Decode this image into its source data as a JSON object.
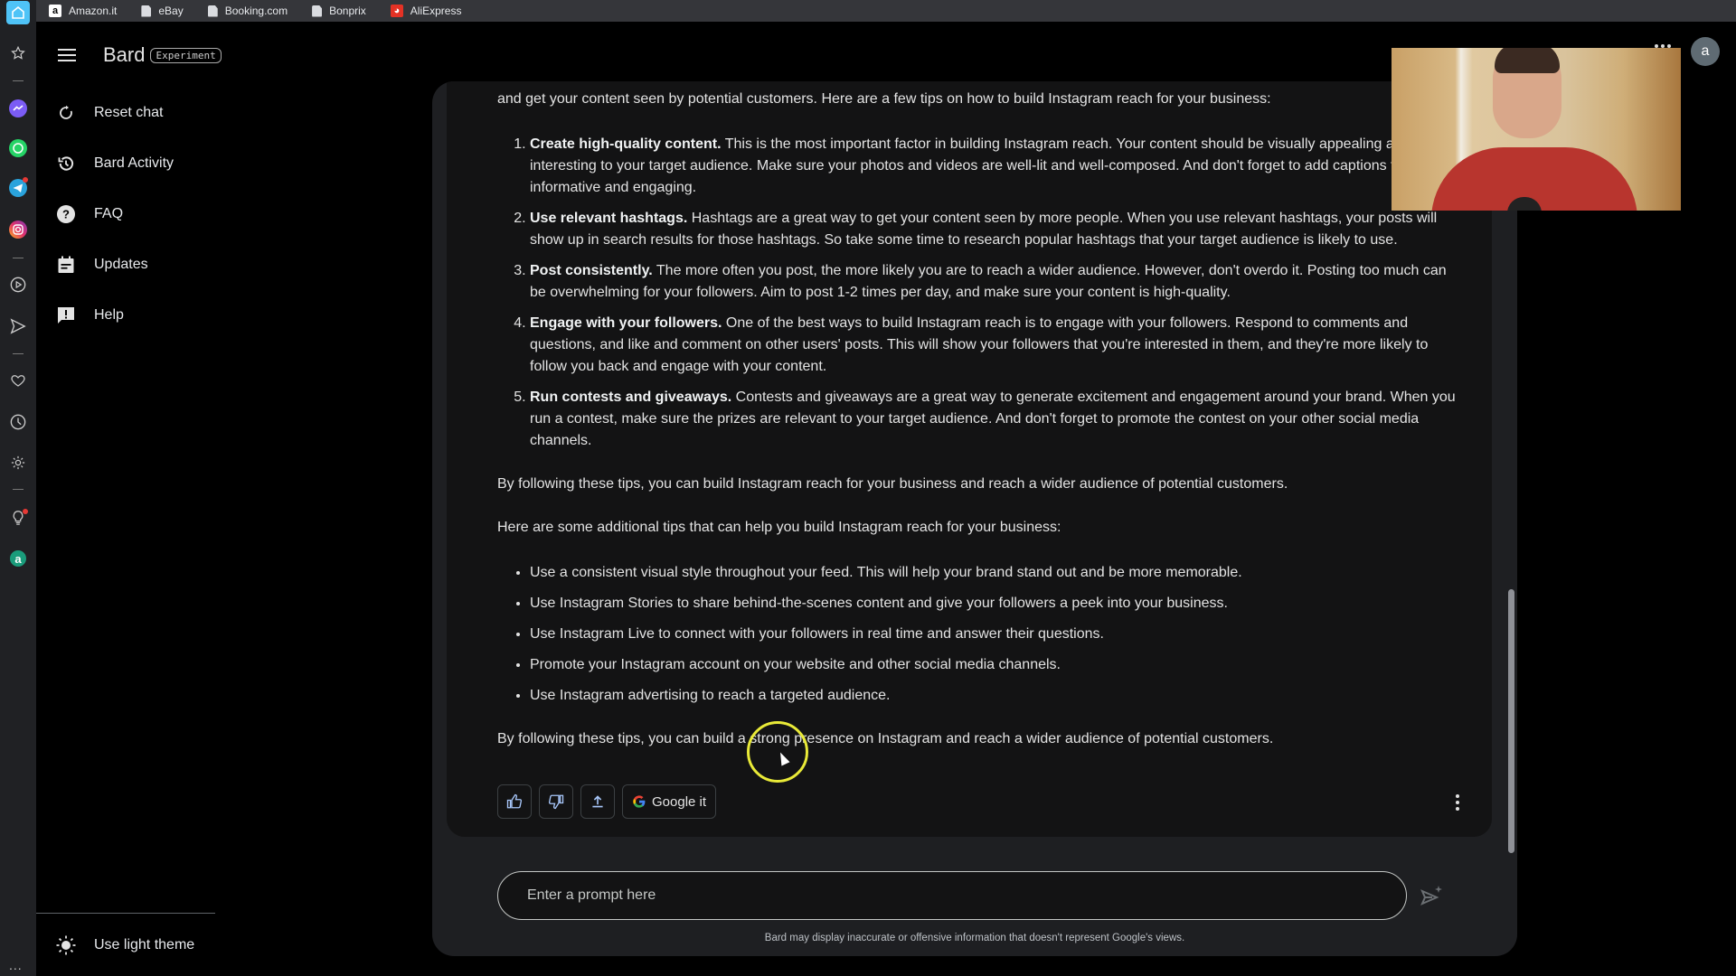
{
  "browser": {
    "bookmarks": [
      {
        "label": "Amazon.it",
        "icon": "amazon-icon"
      },
      {
        "label": "eBay",
        "icon": "page-icon"
      },
      {
        "label": "Booking.com",
        "icon": "page-icon"
      },
      {
        "label": "Bonprix",
        "icon": "page-icon"
      },
      {
        "label": "AliExpress",
        "icon": "aliexpress-icon"
      }
    ]
  },
  "app_rail": {
    "icons": [
      "home-icon",
      "star-icon",
      "messenger-icon",
      "whatsapp-icon",
      "telegram-icon",
      "instagram-icon",
      "play-icon",
      "send-icon",
      "heart-icon",
      "clock-icon",
      "gear-icon",
      "lightbulb-icon",
      "account-icon"
    ],
    "account_letter": "a",
    "more_label": "..."
  },
  "sidebar": {
    "brand": "Bard",
    "badge": "Experiment",
    "items": [
      {
        "label": "Reset chat",
        "icon": "reset-icon"
      },
      {
        "label": "Bard Activity",
        "icon": "history-icon"
      },
      {
        "label": "FAQ",
        "icon": "help-circle-icon"
      },
      {
        "label": "Updates",
        "icon": "calendar-icon"
      },
      {
        "label": "Help",
        "icon": "feedback-icon"
      }
    ],
    "theme_toggle": "Use light theme"
  },
  "response": {
    "intro": "and get your content seen by potential customers. Here are a few tips on how to build Instagram reach for your business:",
    "tips": [
      {
        "title": "Create high-quality content.",
        "body": " This is the most important factor in building Instagram reach. Your content should be visually appealing and interesting to your target audience. Make sure your photos and videos are well-lit and well-composed. And don't forget to add captions that are informative and engaging."
      },
      {
        "title": "Use relevant hashtags.",
        "body": " Hashtags are a great way to get your content seen by more people. When you use relevant hashtags, your posts will show up in search results for those hashtags. So take some time to research popular hashtags that your target audience is likely to use."
      },
      {
        "title": "Post consistently.",
        "body": " The more often you post, the more likely you are to reach a wider audience. However, don't overdo it. Posting too much can be overwhelming for your followers. Aim to post 1-2 times per day, and make sure your content is high-quality."
      },
      {
        "title": "Engage with your followers.",
        "body": " One of the best ways to build Instagram reach is to engage with your followers. Respond to comments and questions, and like and comment on other users' posts. This will show your followers that you're interested in them, and they're more likely to follow you back and engage with your content."
      },
      {
        "title": "Run contests and giveaways.",
        "body": " Contests and giveaways are a great way to generate excitement and engagement around your brand. When you run a contest, make sure the prizes are relevant to your target audience. And don't forget to promote the contest on your other social media channels."
      }
    ],
    "summary1": "By following these tips, you can build Instagram reach for your business and reach a wider audience of potential customers.",
    "additional_intro": "Here are some additional tips that can help you build Instagram reach for your business:",
    "additional_tips": [
      "Use a consistent visual style throughout your feed. This will help your brand stand out and be more memorable.",
      "Use Instagram Stories to share behind-the-scenes content and give your followers a peek into your business.",
      "Use Instagram Live to connect with your followers in real time and answer their questions.",
      "Promote your Instagram account on your website and other social media channels.",
      "Use Instagram advertising to reach a targeted audience."
    ],
    "summary2": "By following these tips, you can build a strong presence on Instagram and reach a wider audience of potential customers."
  },
  "actions": {
    "google_it": "Google it"
  },
  "prompt": {
    "placeholder": "Enter a prompt here",
    "value": ""
  },
  "disclaimer": "Bard may display inaccurate or offensive information that doesn't represent Google's views.",
  "user": {
    "avatar_letter": "a"
  },
  "colors": {
    "accent": "#a8c7fa",
    "background": "#131314",
    "cursor_highlight": "#e9ea38"
  }
}
